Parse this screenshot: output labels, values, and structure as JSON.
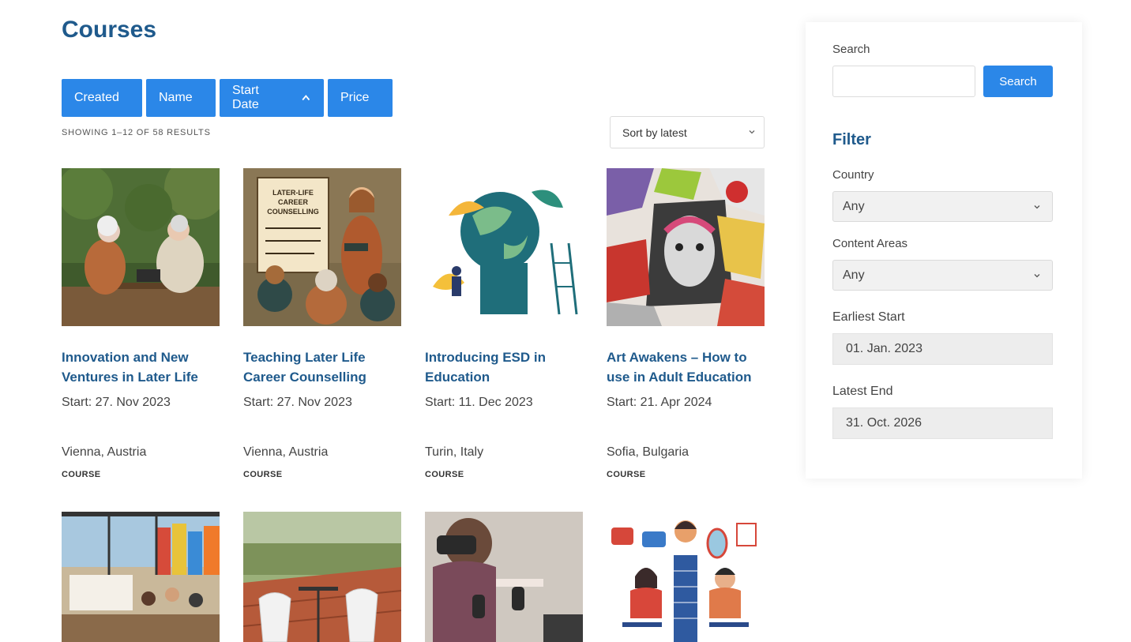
{
  "page_title": "Courses",
  "sort_buttons": [
    {
      "label": "Created"
    },
    {
      "label": "Name"
    },
    {
      "label": "Start Date"
    },
    {
      "label": "Price"
    }
  ],
  "results_count": "SHOWING 1–12 OF 58 RESULTS",
  "orderby": {
    "selected": "Sort by latest"
  },
  "courses": [
    {
      "title": "Innovation and New Ventures in Later Life",
      "start": "Start: 27. Nov 2023",
      "location": "Vienna, Austria",
      "tag": "COURSE",
      "image": "two seniors talking at garden table with laptop"
    },
    {
      "title": "Teaching Later Life Career Counselling",
      "start": "Start: 27. Nov 2023",
      "location": "Vienna, Austria",
      "tag": "COURSE",
      "image": "illustration of teacher presenting career counselling flipchart"
    },
    {
      "title": "Introducing ESD in Education",
      "start": "Start: 11. Dec 2023",
      "location": "Turin, Italy",
      "tag": "COURSE",
      "image": "illustration of people building a globe with plants"
    },
    {
      "title": "Art Awakens – How to use in Adult Education",
      "start": "Start: 21. Apr 2024",
      "location": "Sofia, Bulgaria",
      "tag": "COURSE",
      "image": "collage of art cards with painted faces"
    }
  ],
  "courses_row2": [
    {
      "image": "workshop in cafe with colourful city houses"
    },
    {
      "image": "balcony with white chairs over rooftops"
    },
    {
      "image": "woman using VR headset with controllers"
    },
    {
      "image": "illustration of two people talking with social media icons"
    }
  ],
  "sidebar": {
    "search_label": "Search",
    "search_button": "Search",
    "search_value": "",
    "filter_heading": "Filter",
    "country_label": "Country",
    "country_value": "Any",
    "content_areas_label": "Content Areas",
    "content_areas_value": "Any",
    "earliest_start_label": "Earliest Start",
    "earliest_start_value": "01. Jan. 2023",
    "latest_end_label": "Latest End",
    "latest_end_value": "31. Oct. 2026"
  },
  "colors": {
    "accent": "#2b87e8",
    "title": "#1f5a8c"
  }
}
